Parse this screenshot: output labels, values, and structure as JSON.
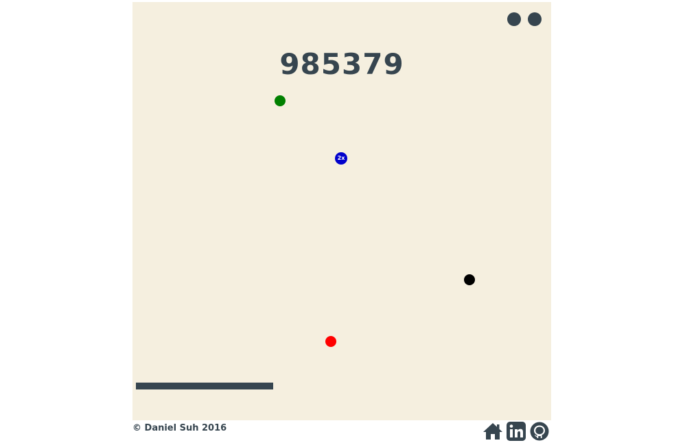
{
  "score": "985379",
  "lives": 2,
  "powerup": {
    "label": "2x"
  },
  "footer": {
    "copyright": "© Daniel Suh 2016",
    "links": [
      {
        "icon": "home-icon"
      },
      {
        "icon": "linkedin-icon"
      },
      {
        "icon": "github-icon"
      }
    ]
  },
  "colors": {
    "background": "#f5efdf",
    "ink": "#36454f",
    "ball_green": "#008000",
    "ball_black": "#000000",
    "ball_red": "#ff0000",
    "powerup": "#0000cc"
  }
}
